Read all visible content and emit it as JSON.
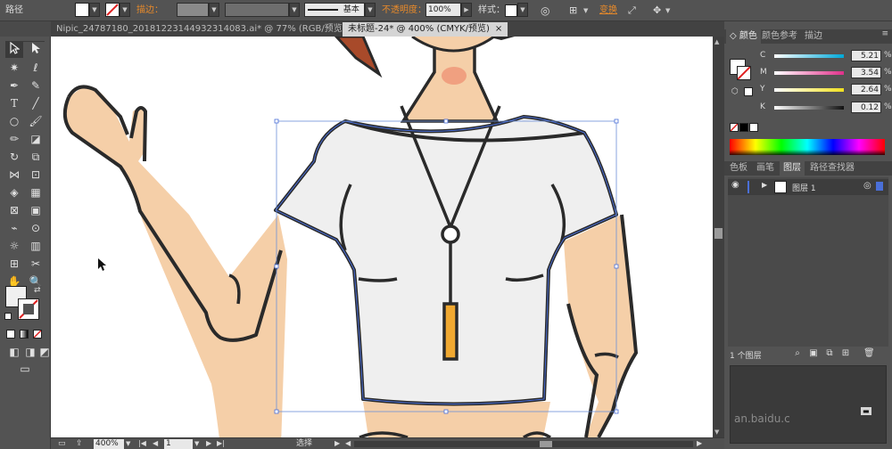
{
  "control_bar": {
    "object_type": "路径",
    "stroke_label": "描边：",
    "stroke_style": "基本",
    "opacity_label": "不透明度：",
    "opacity_value": "100%",
    "style_label": "样式：",
    "transform_label": "变换"
  },
  "tabs": [
    {
      "label": "Nipic_24787180_20181223144932314083.ai* @ 77% (RGB/预览)",
      "close": "×"
    },
    {
      "label": "未标题-24* @ 400% (CMYK/预览)",
      "close": "×"
    }
  ],
  "status": {
    "zoom": "400%",
    "page": "1",
    "tool_name": "选择"
  },
  "panels": {
    "color_tabs": [
      "颜色",
      "颜色参考",
      "描边"
    ],
    "cmyk": [
      {
        "channel": "C",
        "value": "5.21",
        "unit": "%",
        "color": "#00a8d8"
      },
      {
        "channel": "M",
        "value": "3.54",
        "unit": "%",
        "color": "#e0308a"
      },
      {
        "channel": "Y",
        "value": "2.64",
        "unit": "%",
        "color": "#f0e020"
      },
      {
        "channel": "K",
        "value": "0.12",
        "unit": "%",
        "color": "#111111"
      }
    ],
    "layer_tabs": [
      "色板",
      "画笔",
      "图层",
      "路径查找器"
    ],
    "layer_name": "图层 1",
    "layer_count": "1 个图层",
    "watermark": "an.baidu.c"
  },
  "colors": {
    "skin": "#f5cfa8",
    "shirt": "#efefef",
    "outline": "#2a2a2a",
    "pendant": "#f0a830",
    "selection": "#4a6fd8",
    "hair": "#a84a2a"
  },
  "icons": {
    "selection_tool": "select-arrow-icon",
    "direct_selection_tool": "direct-select-icon",
    "layer_visibility": "eye-icon"
  }
}
